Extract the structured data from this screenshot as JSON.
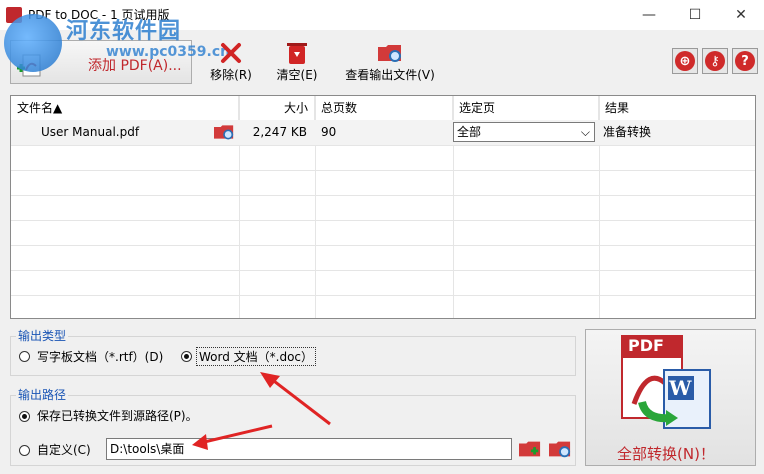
{
  "window": {
    "title": "PDF to DOC - 1 页试用版",
    "minimize": "—",
    "maximize": "☐",
    "close": "✕"
  },
  "watermark": {
    "line1": "河东软件园",
    "line2": "www.pc0359.cn"
  },
  "toolbar": {
    "add_pdf": "添加 PDF(A)...",
    "remove": "移除(R)",
    "clear": "清空(E)",
    "view_output": "查看输出文件(V)"
  },
  "right_buttons": {
    "web": "web-icon",
    "key": "key-icon",
    "help": "?"
  },
  "table": {
    "columns": [
      "文件名▲",
      "大小",
      "总页数",
      "选定页",
      "结果"
    ],
    "rows": [
      {
        "name": "User Manual.pdf",
        "size": "2,247 KB",
        "pages": "90",
        "selected": "全部",
        "result": "准备转换"
      }
    ]
  },
  "output_type": {
    "title": "输出类型",
    "option_rtf": "写字板文档（*.rtf）(D)",
    "option_doc": "Word 文档（*.doc）",
    "selected": "doc"
  },
  "output_path": {
    "title": "输出路径",
    "option_source": "保存已转换文件到源路径(P)。",
    "option_custom": "自定义(C)",
    "path_value": "D:\\tools\\桌面",
    "selected": "source"
  },
  "convert": {
    "label": "全部转换(N)！",
    "icon_text": "PDF"
  },
  "colors": {
    "accent_red": "#c0282d",
    "group_blue": "#1a55b5",
    "annotation_arrow": "#e02424"
  }
}
